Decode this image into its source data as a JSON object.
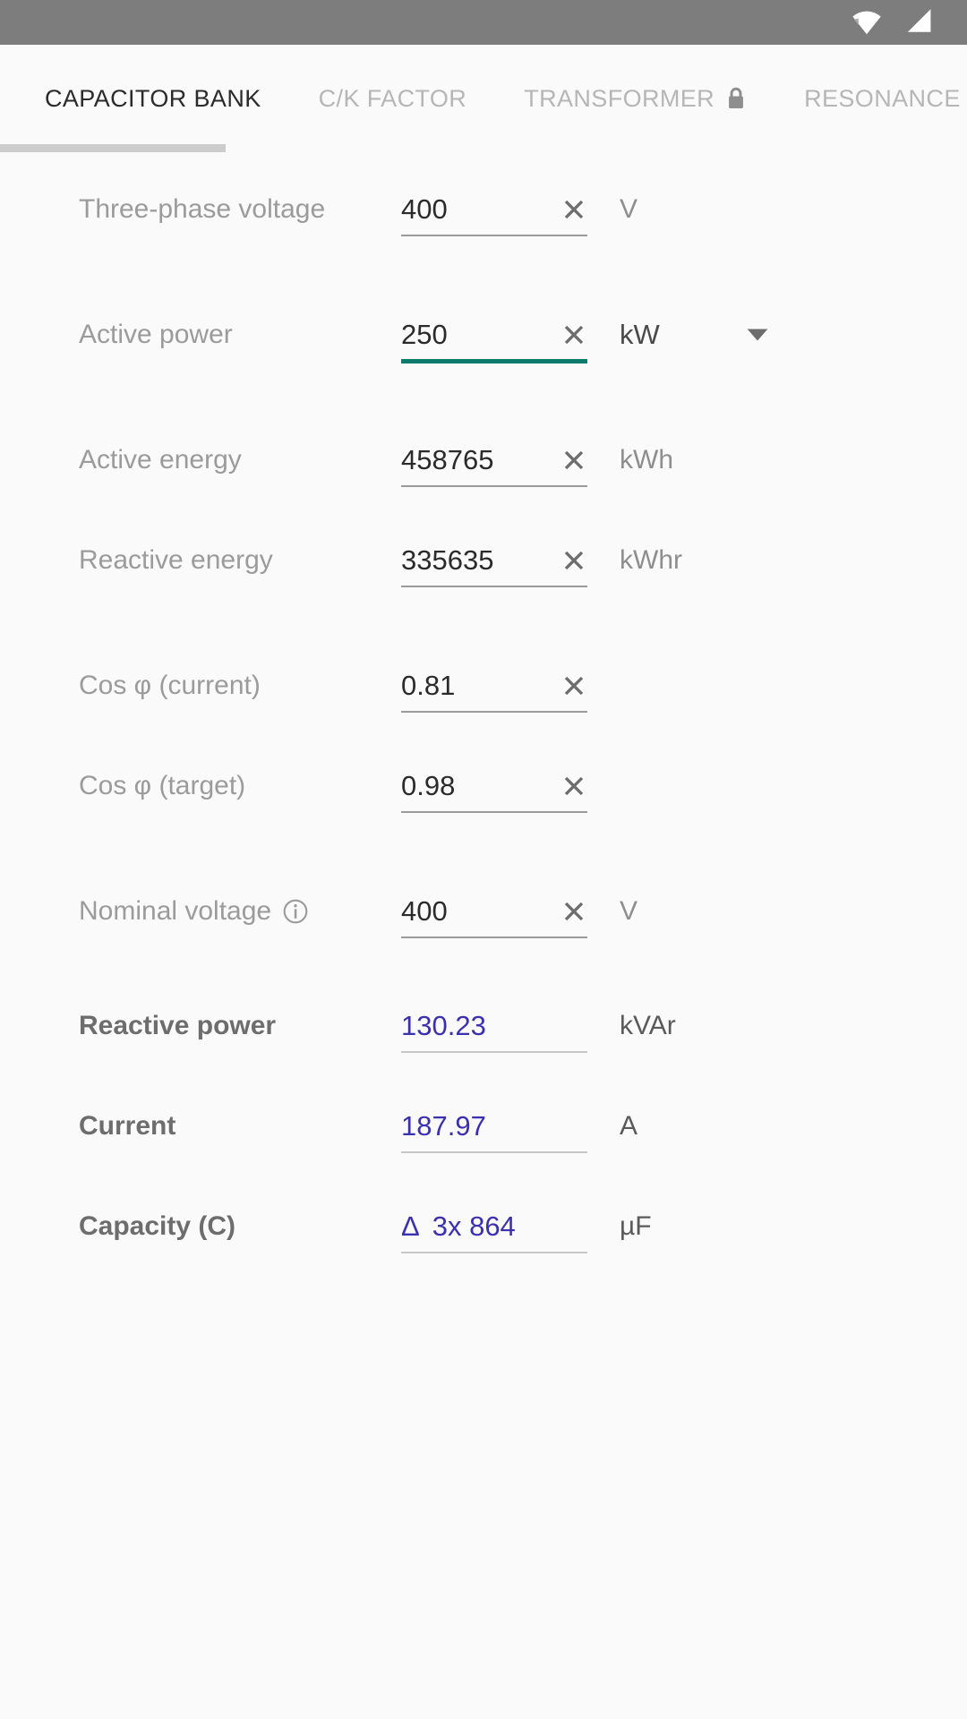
{
  "status_bar": {
    "wifi_icon": "wifi-icon",
    "signal_icon": "cellular-signal-icon",
    "background_color": "#7d7d7d"
  },
  "tabs": {
    "active_index": 0,
    "items": [
      {
        "label": "CAPACITOR BANK",
        "locked": false
      },
      {
        "label": "C/K FACTOR",
        "locked": false
      },
      {
        "label": "TRANSFORMER",
        "locked": true,
        "lock_icon": "lock-icon"
      },
      {
        "label": "RESONANCE",
        "locked": false
      }
    ],
    "indicator_color": "#cccccc"
  },
  "colors": {
    "accent_focus": "#0c7a6d",
    "computed_value": "#3b31b0",
    "label": "#9b9b9b",
    "result_label": "#6d6d6d",
    "background": "#fafafa"
  },
  "form": {
    "clear_icon": "clear-x-icon",
    "dropdown_icon": "chevron-down-icon",
    "info_icon": "info-icon",
    "fields": [
      {
        "id": "three-phase-voltage",
        "label": "Three-phase voltage",
        "value": "400",
        "unit": "V",
        "clearable": true,
        "focused": false,
        "computed": false,
        "has_dropdown": false,
        "has_info": false
      },
      {
        "id": "active-power",
        "label": "Active power",
        "value": "250",
        "unit": "kW",
        "clearable": true,
        "focused": true,
        "computed": false,
        "has_dropdown": true,
        "has_info": false
      },
      {
        "id": "active-energy",
        "label": "Active energy",
        "value": "458765",
        "unit": "kWh",
        "clearable": true,
        "focused": false,
        "computed": false,
        "has_dropdown": false,
        "has_info": false
      },
      {
        "id": "reactive-energy",
        "label": "Reactive energy",
        "value": "335635",
        "unit": "kWhr",
        "clearable": true,
        "focused": false,
        "computed": false,
        "has_dropdown": false,
        "has_info": false
      },
      {
        "id": "cos-phi-current",
        "label": "Cos φ (current)",
        "value": "0.81",
        "unit": "",
        "clearable": true,
        "focused": false,
        "computed": false,
        "has_dropdown": false,
        "has_info": false
      },
      {
        "id": "cos-phi-target",
        "label": "Cos φ (target)",
        "value": "0.98",
        "unit": "",
        "clearable": true,
        "focused": false,
        "computed": false,
        "has_dropdown": false,
        "has_info": false
      },
      {
        "id": "nominal-voltage",
        "label": "Nominal voltage",
        "value": "400",
        "unit": "V",
        "clearable": true,
        "focused": false,
        "computed": false,
        "has_dropdown": false,
        "has_info": true
      },
      {
        "id": "reactive-power",
        "label": "Reactive power",
        "value": "130.23",
        "unit": "kVAr",
        "clearable": false,
        "focused": false,
        "computed": true,
        "has_dropdown": false,
        "has_info": false
      },
      {
        "id": "current",
        "label": "Current",
        "value": "187.97",
        "unit": "A",
        "clearable": false,
        "focused": false,
        "computed": true,
        "has_dropdown": false,
        "has_info": false
      },
      {
        "id": "capacity",
        "label": "Capacity (C)",
        "prefix": "Δ",
        "value": "3x 864",
        "unit": "µF",
        "clearable": false,
        "focused": false,
        "computed": true,
        "has_dropdown": false,
        "has_info": false
      }
    ]
  }
}
